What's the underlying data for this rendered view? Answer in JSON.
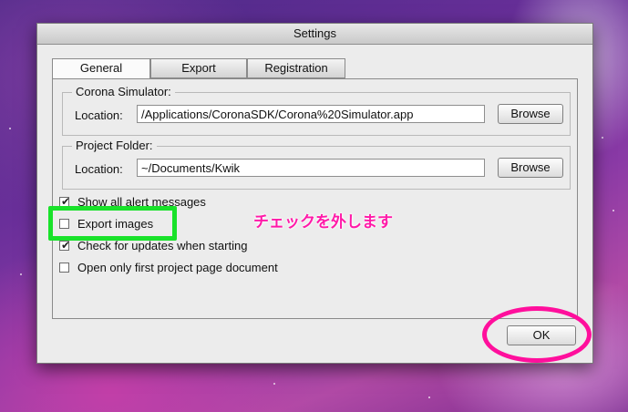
{
  "window": {
    "title": "Settings"
  },
  "tabs": [
    {
      "label": "General",
      "active": true
    },
    {
      "label": "Export",
      "active": false
    },
    {
      "label": "Registration",
      "active": false
    }
  ],
  "corona_group": {
    "title": "Corona Simulator:",
    "location_label": "Location:",
    "location_value": "/Applications/CoronaSDK/Corona%20Simulator.app",
    "browse_label": "Browse"
  },
  "project_group": {
    "title": "Project Folder:",
    "location_label": "Location:",
    "location_value": "~/Documents/Kwik",
    "browse_label": "Browse"
  },
  "options": [
    {
      "label": "Show all alert messages",
      "checked": true
    },
    {
      "label": "Export images",
      "checked": false
    },
    {
      "label": "Check for updates when starting",
      "checked": true
    },
    {
      "label": "Open only first project page document",
      "checked": false
    }
  ],
  "footer": {
    "ok_label": "OK"
  },
  "annotation": {
    "text": "チェックを外します",
    "color": "#ff1aa8",
    "highlight_color": "#19e22a",
    "ring_color": "#ff0f9c"
  }
}
